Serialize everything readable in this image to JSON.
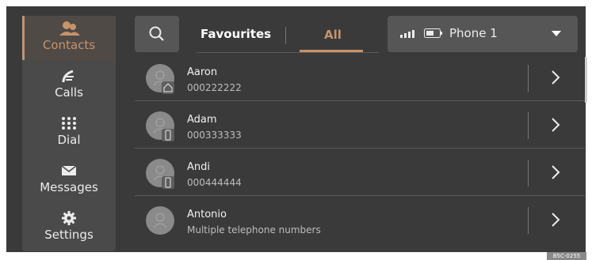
{
  "sidebar": {
    "items": [
      {
        "label": "Contacts",
        "icon": "contacts-icon",
        "active": true
      },
      {
        "label": "Calls",
        "icon": "calls-icon"
      },
      {
        "label": "Dial",
        "icon": "dialpad-icon"
      },
      {
        "label": "Messages",
        "icon": "envelope-icon"
      },
      {
        "label": "Settings",
        "icon": "gear-icon"
      }
    ]
  },
  "header": {
    "tabs": [
      {
        "label": "Favourites"
      },
      {
        "label": "All",
        "active": true
      }
    ],
    "phone": {
      "name": "Phone 1"
    }
  },
  "contacts": [
    {
      "name": "Aaron",
      "number": "000222222",
      "badge": "home-icon"
    },
    {
      "name": "Adam",
      "number": "000333333",
      "badge": "mobile-icon"
    },
    {
      "name": "Andi",
      "number": "000444444",
      "badge": "mobile-icon"
    },
    {
      "name": "Antonio",
      "number": "Multiple telephone numbers",
      "badge": ""
    }
  ],
  "footer": {
    "figure_tag": "B5C-0255"
  },
  "colors": {
    "accent": "#c7936a",
    "background": "#3a3a3a",
    "panel": "#565656"
  }
}
